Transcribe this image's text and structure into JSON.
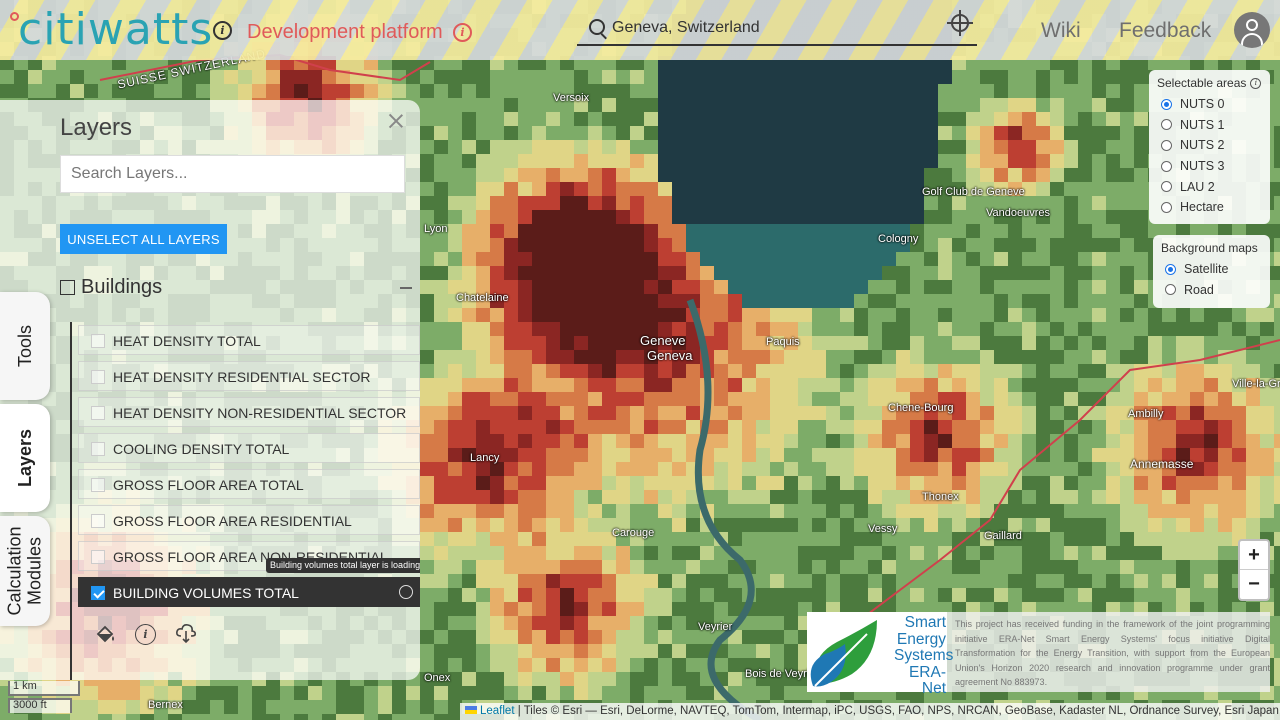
{
  "header": {
    "logo_text": "citiwatts",
    "platform_label": "Development platform",
    "search_value": "Geneva, Switzerland",
    "nav": {
      "wiki": "Wiki",
      "feedback": "Feedback"
    }
  },
  "side_tabs": {
    "tools": "Tools",
    "layers": "Layers",
    "calculation_modules": "Calculation Modules"
  },
  "layers_panel": {
    "title": "Layers",
    "search_placeholder": "Search Layers...",
    "unselect_all_label": "UNSELECT ALL LAYERS",
    "category": "Buildings",
    "layers": [
      {
        "label": "HEAT DENSITY TOTAL",
        "checked": false
      },
      {
        "label": "HEAT DENSITY RESIDENTIAL SECTOR",
        "checked": false
      },
      {
        "label": "HEAT DENSITY NON-RESIDENTIAL SECTOR",
        "checked": false
      },
      {
        "label": "COOLING DENSITY TOTAL",
        "checked": false
      },
      {
        "label": "GROSS FLOOR AREA TOTAL",
        "checked": false
      },
      {
        "label": "GROSS FLOOR AREA RESIDENTIAL",
        "checked": false
      },
      {
        "label": "GROSS FLOOR AREA NON-RESIDENTIAL",
        "checked": false
      },
      {
        "label": "BUILDING VOLUMES TOTAL",
        "checked": true
      }
    ],
    "loading_tooltip": "Building volumes total layer is loading"
  },
  "selectable_areas": {
    "title": "Selectable areas",
    "options": [
      "NUTS 0",
      "NUTS 1",
      "NUTS 2",
      "NUTS 3",
      "LAU 2",
      "Hectare"
    ],
    "selected": "NUTS 0"
  },
  "background_maps": {
    "title": "Background maps",
    "options": [
      "Satellite",
      "Road"
    ],
    "selected": "Satellite"
  },
  "zoom": {
    "in": "+",
    "out": "−"
  },
  "funding": {
    "logo_lines": [
      "Smart",
      "Energy",
      "Systems",
      "ERA-Net"
    ],
    "text": "This project has received funding in the framework of the joint programming initiative ERA-Net Smart Energy Systems' focus initiative Digital Transformation for the Energy Transition, with support from the European Union's Horizon 2020 research and innovation programme under grant agreement No 883973."
  },
  "attribution": {
    "leaflet": "Leaflet",
    "text": " | Tiles © Esri — Esri, DeLorme, NAVTEQ, TomTom, Intermap, iPC, USGS, FAO, NPS, NRCAN, GeoBase, Kadaster NL, Ordnance Survey, Esri Japan,"
  },
  "scale": {
    "km": "1 km",
    "ft": "3000 ft"
  },
  "map_labels": [
    "Geneve",
    "Geneva",
    "SUISSE  SWITZERLAND",
    "Versoix",
    "Golf Club de Geneve",
    "Vandoeuvres",
    "Cologny",
    "Chene-Bourg",
    "Thonex",
    "Ambilly",
    "Annemasse",
    "Carouge",
    "Lancy",
    "Veyrier",
    "Bois de Veyrier",
    "Paquis",
    "Lyon",
    "Chatelaine",
    "Gaillard",
    "Ville-la-Grand",
    "Vessy",
    "Onex",
    "Bernex"
  ]
}
